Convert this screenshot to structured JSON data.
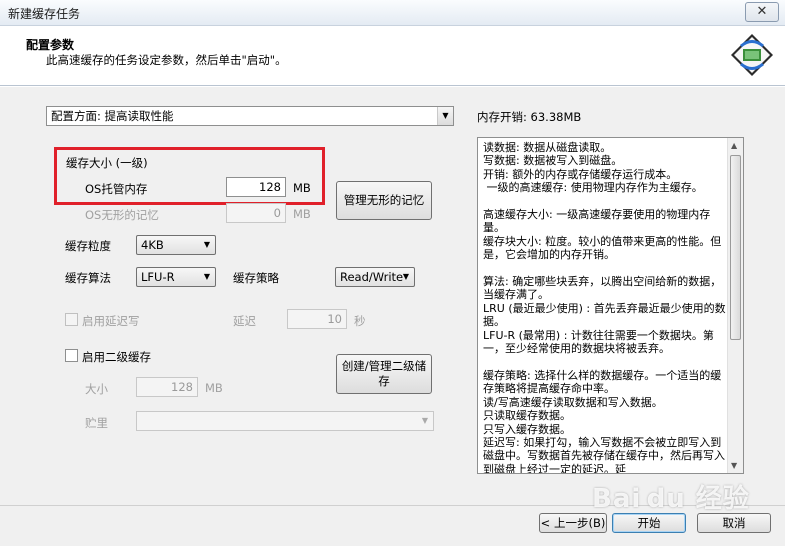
{
  "window": {
    "title": "新建缓存任务",
    "close_glyph": "✕"
  },
  "header": {
    "title": "配置参数",
    "subtitle": "此高速缓存的任务设定参数，然后单击\"启动\"。",
    "logo_icon": "wizard-cache-icon"
  },
  "config": {
    "aspect_value": "配置方面: 提高读取性能",
    "memory_overhead": "内存开销: 63.38MB"
  },
  "cache_size": {
    "group_label": "缓存大小 (一级)",
    "os_managed_label": "OS托管内存",
    "os_managed_value": "128",
    "os_managed_unit": "MB",
    "os_invisible_label": "OS无形的记忆",
    "os_invisible_value": "0",
    "os_invisible_unit": "MB",
    "manage_button": "管理无形的记忆"
  },
  "granularity": {
    "label": "缓存粒度",
    "value": "4KB"
  },
  "algorithm": {
    "label": "缓存算法",
    "value": "LFU-R"
  },
  "strategy": {
    "label": "缓存策略",
    "value": "Read/Write"
  },
  "delayed_write": {
    "checked": false,
    "label": "启用延迟写",
    "delay_label": "延迟",
    "delay_value": "10",
    "delay_unit": "秒"
  },
  "l2cache": {
    "checked": false,
    "label": "启用二级缓存",
    "size_label": "大小",
    "size_value": "128",
    "size_unit": "MB",
    "storage_label": "贮里",
    "storage_value": "",
    "create_button": "创建/管理二级储存"
  },
  "help_text": "读数据: 数据从磁盘读取。\n写数据: 数据被写入到磁盘。\n开销: 额外的内存或存储缓存运行成本。\n 一级的高速缓存: 使用物理内存作为主缓存。\n\n高速缓存大小: 一级高速缓存要使用的物理内存量。\n缓存块大小: 粒度。较小的值带来更高的性能。但是，它会增加的内存开销。\n\n算法: 确定哪些块丢弃，以腾出空间给新的数据，当缓存满了。\nLRU (最近最少使用) : 首先丢弃最近最少使用的数据。\nLFU-R (最常用) : 计数往往需要一个数据块。第一，至少经常使用的数据块将被丢弃。\n\n缓存策略: 选择什么样的数据缓存。一个适当的缓存策略将提高缓存命中率。\n读/写高速缓存读取数据和写入数据。\n只读取缓存数据。\n只写入缓存数据。\n延迟写: 如果打勾，输入写数据不会被立即写入到磁盘中。写数据首先被存储在缓存中，然后再写入到磁盘上经过一定的延迟。延",
  "footer": {
    "back_button": "< 上一步(B)",
    "start_button": "开始",
    "cancel_button": "取消"
  },
  "watermark": "Bai du 经验",
  "colors": {
    "highlight_box": "#e0202a",
    "default_button_border": "#3c7fb1"
  }
}
